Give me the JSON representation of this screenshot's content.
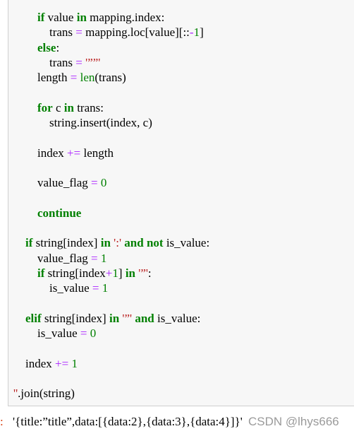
{
  "cell": {
    "lines": [
      [
        {
          "t": "        "
        },
        {
          "t": "if",
          "c": "kw"
        },
        {
          "t": " value "
        },
        {
          "t": "in",
          "c": "kw"
        },
        {
          "t": " mapping.index:"
        }
      ],
      [
        {
          "t": "            trans "
        },
        {
          "t": "=",
          "c": "op"
        },
        {
          "t": " mapping.loc[value][::"
        },
        {
          "t": "-",
          "c": "op"
        },
        {
          "t": "1",
          "c": "num"
        },
        {
          "t": "]"
        }
      ],
      [
        {
          "t": "        "
        },
        {
          "t": "else",
          "c": "kw"
        },
        {
          "t": ":"
        }
      ],
      [
        {
          "t": "            trans "
        },
        {
          "t": "=",
          "c": "op"
        },
        {
          "t": " "
        },
        {
          "t": "'””'",
          "c": "str"
        }
      ],
      [
        {
          "t": "        length "
        },
        {
          "t": "=",
          "c": "op"
        },
        {
          "t": " "
        },
        {
          "t": "len",
          "c": "bi"
        },
        {
          "t": "(trans)"
        }
      ],
      [
        {
          "t": ""
        }
      ],
      [
        {
          "t": "        "
        },
        {
          "t": "for",
          "c": "kw"
        },
        {
          "t": " c "
        },
        {
          "t": "in",
          "c": "kw"
        },
        {
          "t": " trans:"
        }
      ],
      [
        {
          "t": "            string.insert(index, c)"
        }
      ],
      [
        {
          "t": ""
        }
      ],
      [
        {
          "t": "        index "
        },
        {
          "t": "+=",
          "c": "op"
        },
        {
          "t": " length"
        }
      ],
      [
        {
          "t": ""
        }
      ],
      [
        {
          "t": "        value_flag "
        },
        {
          "t": "=",
          "c": "op"
        },
        {
          "t": " "
        },
        {
          "t": "0",
          "c": "num"
        }
      ],
      [
        {
          "t": ""
        }
      ],
      [
        {
          "t": "        "
        },
        {
          "t": "continue",
          "c": "kw"
        }
      ],
      [
        {
          "t": ""
        }
      ],
      [
        {
          "t": "    "
        },
        {
          "t": "if",
          "c": "kw"
        },
        {
          "t": " string[index] "
        },
        {
          "t": "in",
          "c": "kw"
        },
        {
          "t": " "
        },
        {
          "t": "':'",
          "c": "str"
        },
        {
          "t": " "
        },
        {
          "t": "and",
          "c": "kw"
        },
        {
          "t": " "
        },
        {
          "t": "not",
          "c": "kw"
        },
        {
          "t": " is_value:"
        }
      ],
      [
        {
          "t": "        value_flag "
        },
        {
          "t": "=",
          "c": "op"
        },
        {
          "t": " "
        },
        {
          "t": "1",
          "c": "num"
        }
      ],
      [
        {
          "t": "        "
        },
        {
          "t": "if",
          "c": "kw"
        },
        {
          "t": " string[index"
        },
        {
          "t": "+",
          "c": "op"
        },
        {
          "t": "1",
          "c": "num"
        },
        {
          "t": "] "
        },
        {
          "t": "in",
          "c": "kw"
        },
        {
          "t": " "
        },
        {
          "t": "'”'",
          "c": "str"
        },
        {
          "t": ":"
        }
      ],
      [
        {
          "t": "            is_value "
        },
        {
          "t": "=",
          "c": "op"
        },
        {
          "t": " "
        },
        {
          "t": "1",
          "c": "num"
        }
      ],
      [
        {
          "t": ""
        }
      ],
      [
        {
          "t": "    "
        },
        {
          "t": "elif",
          "c": "kw"
        },
        {
          "t": " string[index] "
        },
        {
          "t": "in",
          "c": "kw"
        },
        {
          "t": " "
        },
        {
          "t": "'”'",
          "c": "str"
        },
        {
          "t": " "
        },
        {
          "t": "and",
          "c": "kw"
        },
        {
          "t": " is_value:"
        }
      ],
      [
        {
          "t": "        is_value "
        },
        {
          "t": "=",
          "c": "op"
        },
        {
          "t": " "
        },
        {
          "t": "0",
          "c": "num"
        }
      ],
      [
        {
          "t": ""
        }
      ],
      [
        {
          "t": "    index "
        },
        {
          "t": "+=",
          "c": "op"
        },
        {
          "t": " "
        },
        {
          "t": "1",
          "c": "num"
        }
      ],
      [
        {
          "t": ""
        }
      ],
      [
        {
          "t": "''",
          "c": "str"
        },
        {
          "t": ".join(string)"
        }
      ]
    ]
  },
  "output": {
    "prompt": ":",
    "text": "'{title:”title”,data:[{data:2},{data:3},{data:4}]}'"
  },
  "watermark": "CSDN @lhys666"
}
